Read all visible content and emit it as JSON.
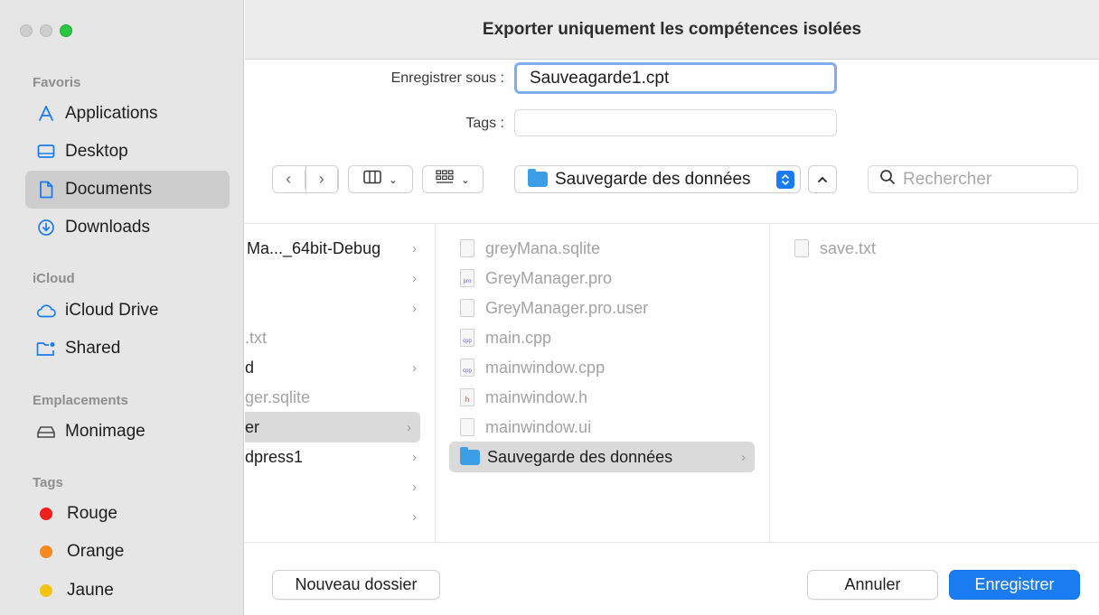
{
  "window": {
    "title": "Exporter uniquement les compétences isolées"
  },
  "sidebar": {
    "sections": {
      "favorites": "Favoris",
      "icloud": "iCloud",
      "locations": "Emplacements",
      "tags": "Tags"
    },
    "favorites": [
      {
        "label": "Applications",
        "icon": "applications-icon"
      },
      {
        "label": "Desktop",
        "icon": "desktop-icon"
      },
      {
        "label": "Documents",
        "icon": "document-icon",
        "selected": true
      },
      {
        "label": "Downloads",
        "icon": "download-icon"
      }
    ],
    "icloud": [
      {
        "label": "iCloud Drive",
        "icon": "cloud-icon"
      },
      {
        "label": "Shared",
        "icon": "shared-folder-icon"
      }
    ],
    "locations": [
      {
        "label": "Monimage",
        "icon": "disk-icon"
      }
    ],
    "tags": [
      {
        "label": "Rouge",
        "color": "#f0201e"
      },
      {
        "label": "Orange",
        "color": "#f7881f"
      },
      {
        "label": "Jaune",
        "color": "#f5c314"
      }
    ]
  },
  "form": {
    "save_as_label": "Enregistrer sous :",
    "save_as_value": "Sauveagarde1.cpt",
    "tags_label": "Tags :"
  },
  "toolbar": {
    "location": "Sauvegarde des données",
    "search_placeholder": "Rechercher"
  },
  "browser": {
    "column1": [
      {
        "label": "Ma..._64bit-Debug",
        "folder": true
      },
      {
        "label": "",
        "folder": true
      },
      {
        "label": "",
        "folder": true
      },
      {
        "label": ".txt",
        "folder": false
      },
      {
        "label": "d",
        "folder": true
      },
      {
        "label": "ger.sqlite",
        "folder": false
      },
      {
        "label": "er",
        "folder": true,
        "selected": true
      },
      {
        "label": "dpress1",
        "folder": true
      },
      {
        "label": "",
        "folder": true
      },
      {
        "label": "",
        "folder": true
      }
    ],
    "column2": [
      {
        "label": "greyMana.sqlite",
        "badge": ""
      },
      {
        "label": "GreyManager.pro",
        "badge": "pro"
      },
      {
        "label": "GreyManager.pro.user",
        "badge": ""
      },
      {
        "label": "main.cpp",
        "badge": "cpp"
      },
      {
        "label": "mainwindow.cpp",
        "badge": "cpp"
      },
      {
        "label": "mainwindow.h",
        "badge": "h"
      },
      {
        "label": "mainwindow.ui",
        "badge": ""
      },
      {
        "label": "Sauvegarde des données",
        "folder": true,
        "selected": true
      }
    ],
    "column3": [
      {
        "label": "save.txt"
      }
    ]
  },
  "buttons": {
    "new_folder": "Nouveau dossier",
    "cancel": "Annuler",
    "save": "Enregistrer"
  }
}
